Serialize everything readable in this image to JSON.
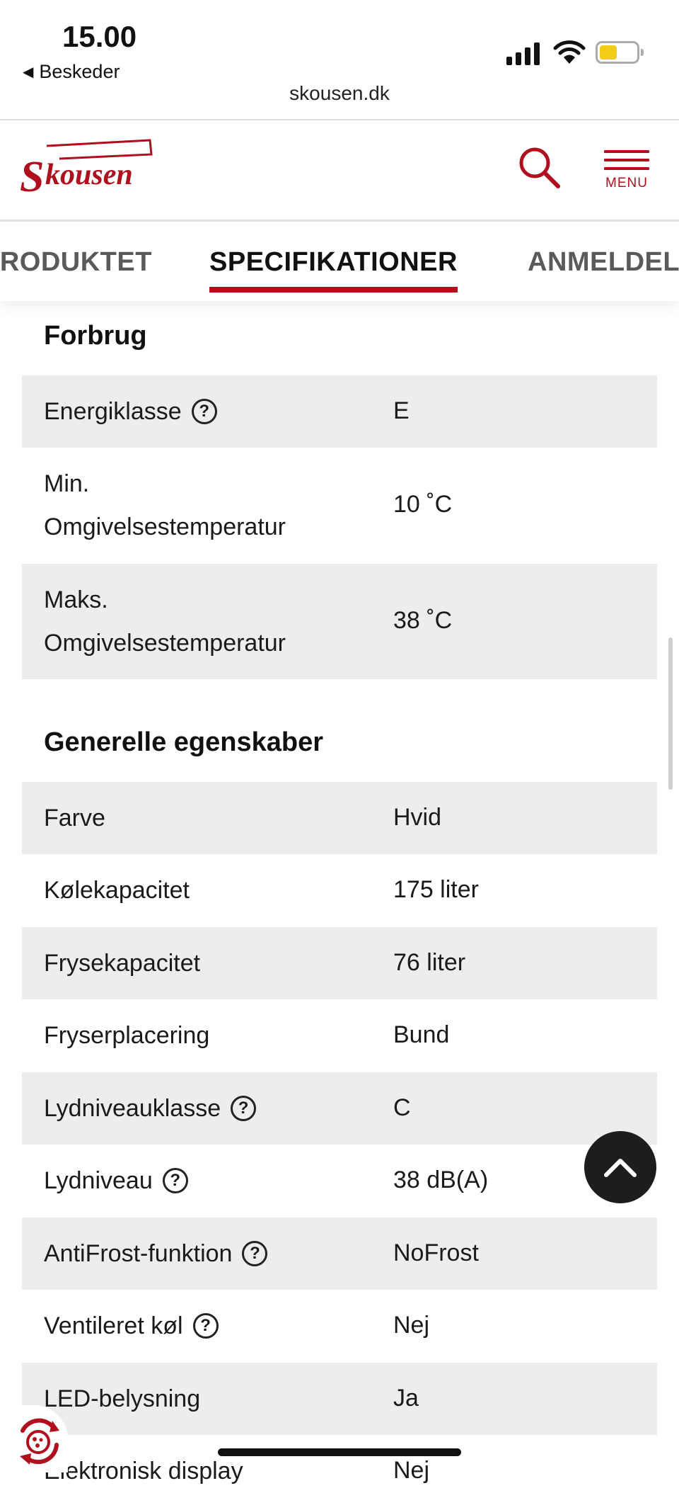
{
  "status_bar": {
    "time": "15.00",
    "back_label": "Beskeder",
    "url": "skousen.dk"
  },
  "header": {
    "logo_text": "Skousen",
    "menu_label": "MENU"
  },
  "tabs": [
    {
      "label": "PRODUKTET",
      "active": false
    },
    {
      "label": "SPECIFIKATIONER",
      "active": true
    },
    {
      "label": "ANMELDELSER",
      "active": false
    }
  ],
  "sections": {
    "forbrug": {
      "title": "Forbrug",
      "rows": [
        {
          "key": "Energiklasse",
          "value": "E",
          "help": true
        },
        {
          "key_line1": "Min.",
          "key_line2": "Omgivelsestemperatur",
          "value": "10 ˚C"
        },
        {
          "key_line1": "Maks.",
          "key_line2": "Omgivelsestemperatur",
          "value": "38 ˚C"
        }
      ]
    },
    "generelle": {
      "title": "Generelle egenskaber",
      "rows": [
        {
          "key": "Farve",
          "value": "Hvid"
        },
        {
          "key": "Kølekapacitet",
          "value": "175 liter"
        },
        {
          "key": "Frysekapacitet",
          "value": "76 liter"
        },
        {
          "key": "Fryserplacering",
          "value": "Bund"
        },
        {
          "key": "Lydniveauklasse",
          "value": "C",
          "help": true
        },
        {
          "key": "Lydniveau",
          "value": "38 dB(A)",
          "help": true
        },
        {
          "key": "AntiFrost-funktion",
          "value": "NoFrost",
          "help": true
        },
        {
          "key": "Ventileret køl",
          "value": "Nej",
          "help": true
        },
        {
          "key": "LED-belysning",
          "value": "Ja"
        },
        {
          "key": "Elektronisk display",
          "value": "Nej"
        }
      ]
    }
  },
  "help_glyph": "?",
  "colors": {
    "brand_red": "#b0101e",
    "row_shade": "#ededed",
    "fab": "#1d1d1d"
  },
  "icons": [
    "signal-icon",
    "wifi-icon",
    "battery-icon",
    "search-icon",
    "menu-icon",
    "help-icon",
    "chevron-up-icon",
    "cookie-icon"
  ]
}
